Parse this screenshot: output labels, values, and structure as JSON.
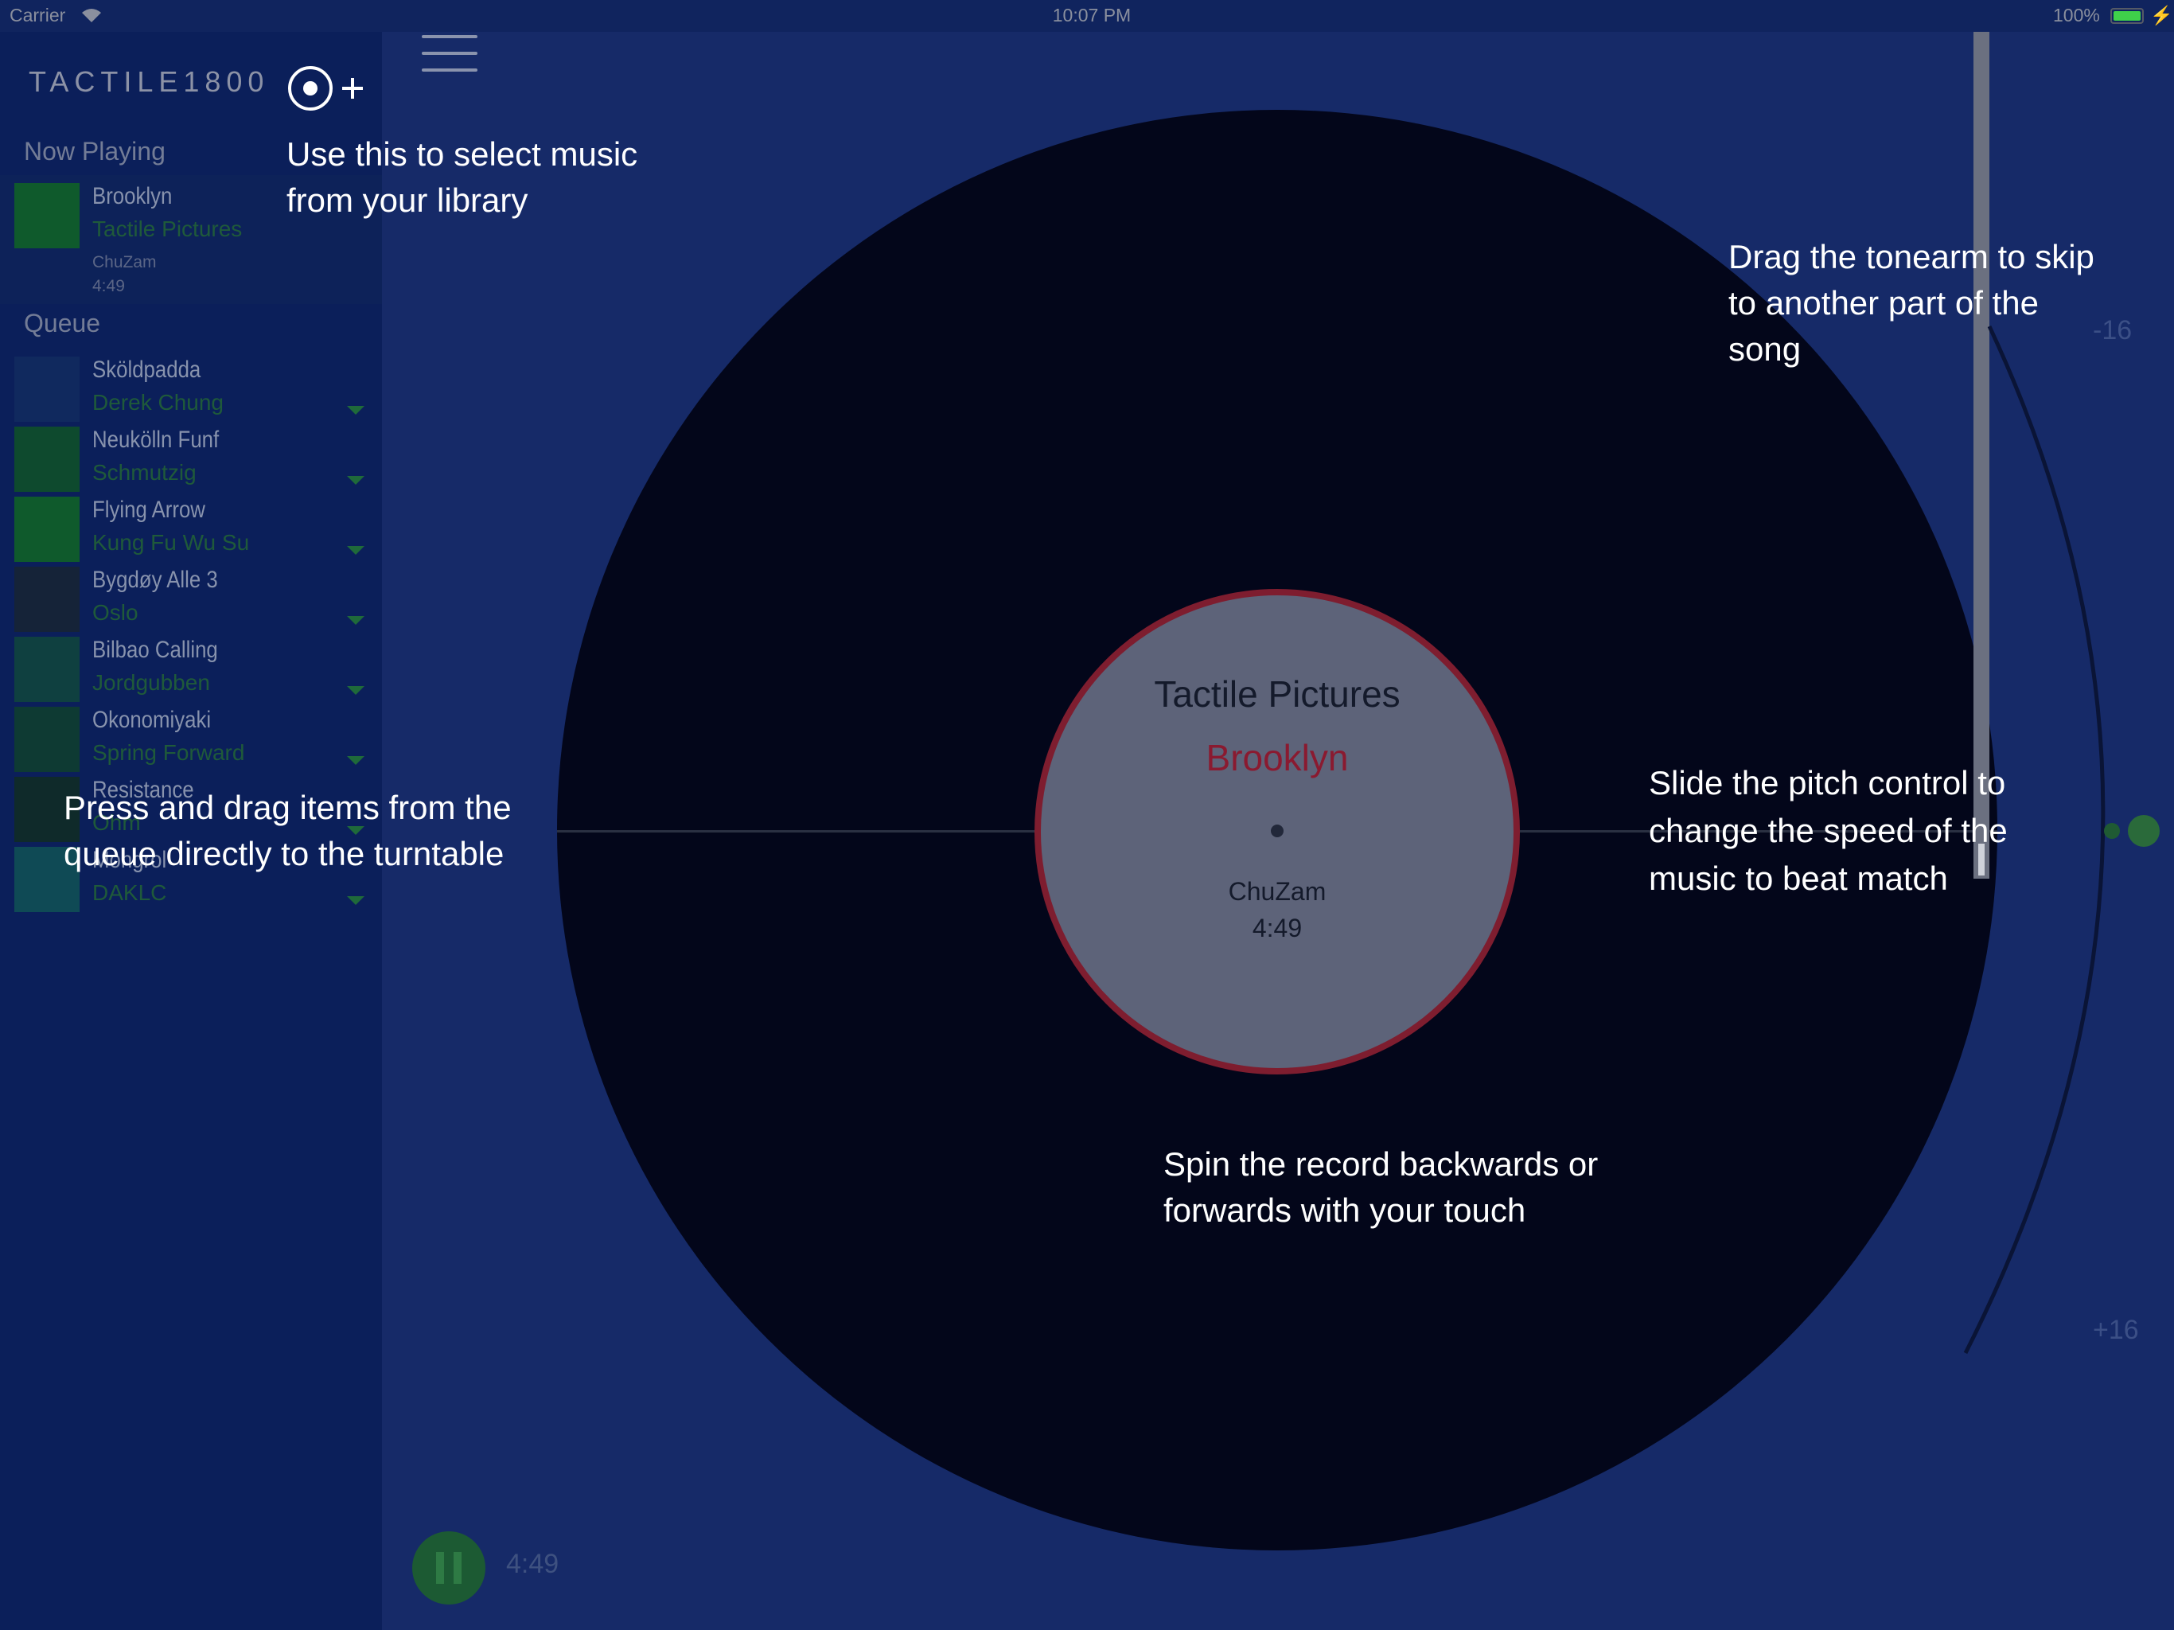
{
  "status_bar": {
    "carrier": "Carrier",
    "time": "10:07 PM",
    "battery": "100%"
  },
  "app": {
    "logo": "TACTILE1800"
  },
  "sidebar": {
    "now_playing_label": "Now Playing",
    "now_playing": {
      "title": "Brooklyn",
      "artist": "Tactile Pictures",
      "album": "ChuZam",
      "duration": "4:49"
    },
    "queue_label": "Queue",
    "queue": [
      {
        "title": "Sköldpadda",
        "artist": "Derek Chung",
        "color": "#10295e"
      },
      {
        "title": "Neukölln Funf",
        "artist": "Schmutzig",
        "color": "#0e4a2e"
      },
      {
        "title": "Flying Arrow",
        "artist": "Kung Fu Wu Su",
        "color": "#0f5a2c"
      },
      {
        "title": "Bygdøy Alle 3",
        "artist": "Oslo",
        "color": "#152338"
      },
      {
        "title": "Bilbao Calling",
        "artist": "Jordgubben",
        "color": "#0f4040"
      },
      {
        "title": "Okonomiyaki",
        "artist": "Spring Forward",
        "color": "#0e3a33"
      },
      {
        "title": "Resistance",
        "artist": "Ohm",
        "color": "#0f2a2a"
      },
      {
        "title": "Mongrol",
        "artist": "DAKLC",
        "color": "#0f4a55"
      }
    ]
  },
  "record": {
    "artist": "Tactile Pictures",
    "title": "Brooklyn",
    "album": "ChuZam",
    "duration": "4:49"
  },
  "pitch": {
    "minus_label": "-16",
    "plus_label": "+16"
  },
  "player": {
    "time": "4:49"
  },
  "hints": {
    "library": [
      "Use this to select music",
      "from your library"
    ],
    "queue": [
      "Press and drag items from the",
      "queue directly to the turntable"
    ],
    "tonearm": [
      "Drag the tonearm to skip",
      "to another part of the",
      "song"
    ],
    "pitch": [
      "Slide the pitch control to",
      "change the speed of the",
      "music to beat match"
    ],
    "spin": [
      "Spin the record backwards or",
      "forwards with your touch"
    ]
  },
  "colors": {
    "background": "#162a68",
    "sidebar": "#0b1f5a",
    "record": "#03061a",
    "label_ring": "#7e1d2f",
    "accent_green": "#1f6a3a"
  }
}
